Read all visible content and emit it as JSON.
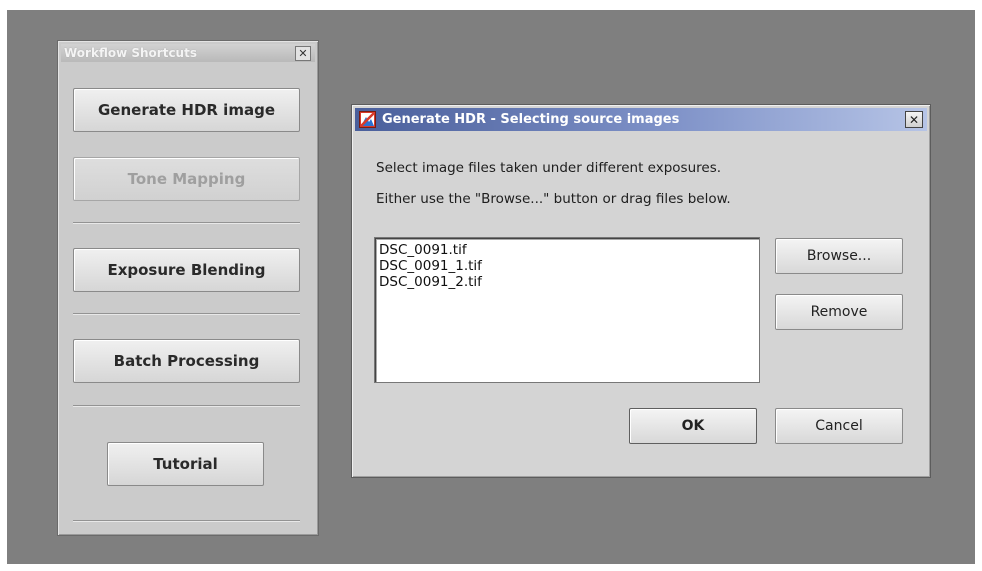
{
  "shortcuts_panel": {
    "title": "Workflow Shortcuts",
    "close_glyph": "✕",
    "buttons": {
      "generate_hdr": "Generate HDR image",
      "tone_mapping": "Tone Mapping",
      "exposure_blending": "Exposure Blending",
      "batch_processing": "Batch Processing",
      "tutorial": "Tutorial"
    }
  },
  "dialog": {
    "title": "Generate HDR - Selecting source images",
    "close_glyph": "✕",
    "instruction_line1": "Select image files taken under different exposures.",
    "instruction_line2": "Either use the \"Browse...\" button or drag files below.",
    "files": [
      "DSC_0091.tif",
      "DSC_0091_1.tif",
      "DSC_0091_2.tif"
    ],
    "buttons": {
      "browse": "Browse...",
      "remove": "Remove",
      "ok": "OK",
      "cancel": "Cancel"
    }
  },
  "icons": {
    "app_icon": "photomatix-app-icon",
    "close": "close-icon"
  },
  "colors": {
    "desktop": "#7f7f7f",
    "panel": "#cbcbcb",
    "dialog": "#d4d4d4",
    "titlebar_active": "#4a5f9b"
  }
}
